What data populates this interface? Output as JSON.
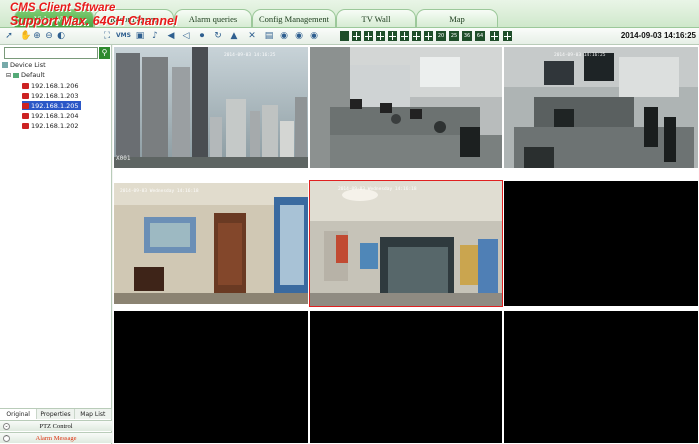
{
  "watermark": {
    "line1": "CMS Client Sftware",
    "line2": "Support Max. 64CH Channel"
  },
  "tabs": [
    {
      "label": "Video View",
      "active": true
    },
    {
      "label": "Record Query",
      "active": false
    },
    {
      "label": "Alarm queries",
      "active": false
    },
    {
      "label": "Config Management",
      "active": false
    },
    {
      "label": "TV Wall",
      "active": false
    },
    {
      "label": "Map",
      "active": false
    }
  ],
  "toolbar": {
    "datetime": "2014-09-03 14:16:25",
    "vms_label": "VMS",
    "split_labels": [
      "20",
      "25",
      "36",
      "64"
    ]
  },
  "sidebar": {
    "search_placeholder": "",
    "tree_title": "Device List",
    "group": "Default",
    "devices": [
      "192.168.1.206",
      "192.168.1.203",
      "192.168.1.205",
      "192.168.1.204",
      "192.168.1.202"
    ],
    "selected_index": 2,
    "bottom_tabs": [
      "Original",
      "Properties",
      "Map List"
    ],
    "ptz_label": "PTZ Control",
    "alarm_label": "Alarm Message"
  },
  "grid": {
    "osd": [
      "2014-09-03 14:16:25",
      "",
      "2014-09-03 14:16:25",
      "2014-09-03 Wednesday 14:16:18",
      "2014-09-03 Wednesday 14:16:18",
      "",
      "",
      "",
      ""
    ],
    "corner_label": "X001",
    "selected_cell": 4
  },
  "colors": {
    "accent": "#4aa543",
    "selection": "#e02020",
    "tree_selection": "#2b57c7"
  }
}
